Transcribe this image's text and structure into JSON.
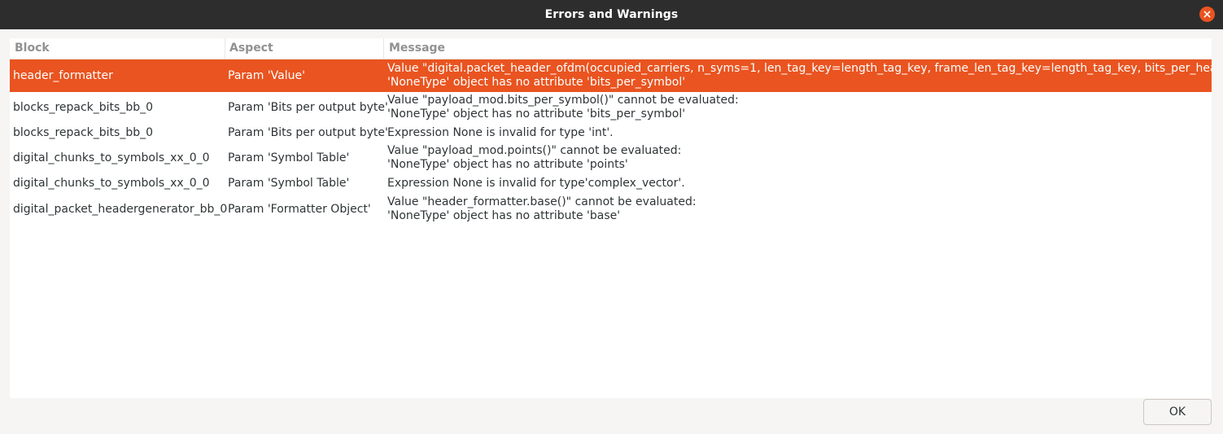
{
  "window": {
    "title": "Errors and Warnings"
  },
  "table": {
    "columns": [
      "Block",
      "Aspect",
      "Message"
    ],
    "rows": [
      {
        "block": "header_formatter",
        "aspect": "Param 'Value'",
        "message": [
          "Value \"digital.packet_header_ofdm(occupied_carriers, n_syms=1, len_tag_key=length_tag_key, frame_len_tag_key=length_tag_key, bits_per_header_sym",
          "'NoneType' object has no attribute 'bits_per_symbol'"
        ],
        "selected": true
      },
      {
        "block": "blocks_repack_bits_bb_0",
        "aspect": "Param 'Bits per output byte'",
        "message": [
          "Value \"payload_mod.bits_per_symbol()\" cannot be evaluated:",
          "'NoneType' object has no attribute 'bits_per_symbol'"
        ],
        "selected": false
      },
      {
        "block": "blocks_repack_bits_bb_0",
        "aspect": "Param 'Bits per output byte'",
        "message": [
          "Expression None is invalid for type 'int'."
        ],
        "selected": false
      },
      {
        "block": "digital_chunks_to_symbols_xx_0_0",
        "aspect": "Param 'Symbol Table'",
        "message": [
          "Value \"payload_mod.points()\" cannot be evaluated:",
          "'NoneType' object has no attribute 'points'"
        ],
        "selected": false
      },
      {
        "block": "digital_chunks_to_symbols_xx_0_0",
        "aspect": "Param 'Symbol Table'",
        "message": [
          "Expression None is invalid for type'complex_vector'."
        ],
        "selected": false
      },
      {
        "block": "digital_packet_headergenerator_bb_0",
        "aspect": "Param 'Formatter Object'",
        "message": [
          "Value \"header_formatter.base()\" cannot be evaluated:",
          "'NoneType' object has no attribute 'base'"
        ],
        "selected": false
      }
    ]
  },
  "buttons": {
    "ok_label": "OK"
  },
  "colors": {
    "selection": "#e95420",
    "titlebar": "#2d2d2d",
    "close_button": "#e95420"
  },
  "icons": {
    "close": "close-icon"
  }
}
